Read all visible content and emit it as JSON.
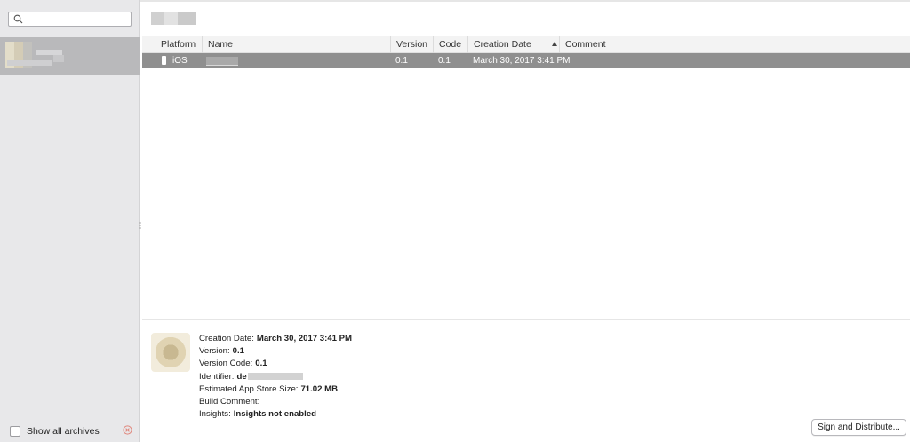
{
  "search": {
    "placeholder": "",
    "icon": "search-icon"
  },
  "sidebar": {
    "show_all_label": "Show all archives",
    "show_all_checked": false
  },
  "table": {
    "columns": [
      "Platform",
      "Name",
      "Version",
      "Code",
      "Creation Date",
      "Comment"
    ],
    "sorted_column": "Creation Date",
    "sort_direction": "ascending",
    "rows": [
      {
        "platform": "iOS",
        "name": "",
        "version": "0.1",
        "code": "0.1",
        "creation_date": "March 30, 2017 3:41 PM",
        "comment": ""
      }
    ]
  },
  "details": {
    "creation_date_label": "Creation Date:",
    "creation_date_value": "March 30, 2017 3:41 PM",
    "version_label": "Version:",
    "version_value": "0.1",
    "version_code_label": "Version Code:",
    "version_code_value": "0.1",
    "identifier_label": "Identifier:",
    "identifier_value": "de",
    "size_label": "Estimated App Store Size:",
    "size_value": "71.02 MB",
    "build_comment_label": "Build Comment:",
    "build_comment_value": "",
    "insights_label": "Insights:",
    "insights_value": "Insights not enabled"
  },
  "actions": {
    "sign_distribute_label": "Sign and Distribute..."
  },
  "colors": {
    "sidebar_bg": "#e8e8ea",
    "selection_bg": "#8f8f8f",
    "sidebar_selection_bg": "#b9b9bb",
    "clear_icon": "#e0867c"
  }
}
